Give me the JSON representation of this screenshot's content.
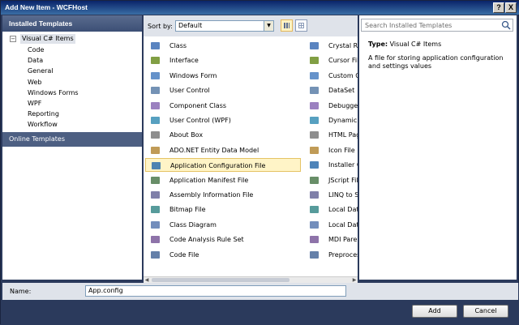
{
  "window": {
    "title": "Add New Item - WCFHost",
    "help_glyph": "?",
    "close_glyph": "X"
  },
  "left": {
    "header": "Installed Templates",
    "root": {
      "expander": "−",
      "label": "Visual C# Items"
    },
    "children": [
      "Code",
      "Data",
      "General",
      "Web",
      "Windows Forms",
      "WPF",
      "Reporting",
      "Workflow"
    ],
    "online": "Online Templates"
  },
  "toolbar": {
    "sort_label": "Sort by:",
    "sort_value": "Default",
    "sort_arrow": "▼"
  },
  "items_col1": [
    {
      "label": "Class",
      "icon": "class-icon"
    },
    {
      "label": "Interface",
      "icon": "interface-icon"
    },
    {
      "label": "Windows Form",
      "icon": "form-icon"
    },
    {
      "label": "User Control",
      "icon": "user-control-icon"
    },
    {
      "label": "Component Class",
      "icon": "component-icon"
    },
    {
      "label": "User Control (WPF)",
      "icon": "wpf-control-icon"
    },
    {
      "label": "About Box",
      "icon": "about-box-icon"
    },
    {
      "label": "ADO.NET Entity Data Model",
      "icon": "entity-model-icon"
    },
    {
      "label": "Application Configuration File",
      "icon": "config-file-icon"
    },
    {
      "label": "Application Manifest File",
      "icon": "manifest-icon"
    },
    {
      "label": "Assembly Information File",
      "icon": "assembly-info-icon"
    },
    {
      "label": "Bitmap File",
      "icon": "bitmap-icon"
    },
    {
      "label": "Class Diagram",
      "icon": "class-diagram-icon"
    },
    {
      "label": "Code Analysis Rule Set",
      "icon": "rule-set-icon"
    },
    {
      "label": "Code File",
      "icon": "code-file-icon"
    }
  ],
  "items_col2": [
    {
      "label": "Crystal Rep",
      "icon": "crystal-report-icon"
    },
    {
      "label": "Cursor File",
      "icon": "cursor-icon"
    },
    {
      "label": "Custom Co",
      "icon": "custom-control-icon"
    },
    {
      "label": "DataSet",
      "icon": "dataset-icon"
    },
    {
      "label": "Debugger V",
      "icon": "debugger-icon"
    },
    {
      "label": "Dynamic Da",
      "icon": "dynamic-data-icon"
    },
    {
      "label": "HTML Page",
      "icon": "html-page-icon"
    },
    {
      "label": "Icon File",
      "icon": "icon-file-icon"
    },
    {
      "label": "Installer Cla",
      "icon": "installer-icon"
    },
    {
      "label": "JScript File",
      "icon": "jscript-icon"
    },
    {
      "label": "LINQ to SQ",
      "icon": "linq-icon"
    },
    {
      "label": "Local Datab",
      "icon": "local-db-icon"
    },
    {
      "label": "Local Datab",
      "icon": "local-db-cache-icon"
    },
    {
      "label": "MDI Parent",
      "icon": "mdi-parent-icon"
    },
    {
      "label": "Preprocess",
      "icon": "preprocess-icon"
    }
  ],
  "selected_index": 8,
  "search": {
    "placeholder": "Search Installed Templates"
  },
  "details": {
    "type_label": "Type:",
    "type_value": "Visual C# Items",
    "description": "A file for storing application configuration and settings values"
  },
  "name": {
    "label": "Name:",
    "value": "App.config"
  },
  "buttons": {
    "add": "Add",
    "cancel": "Cancel"
  },
  "colors": {
    "accent": "#2b3a5c",
    "selection": "#fff4c7"
  }
}
